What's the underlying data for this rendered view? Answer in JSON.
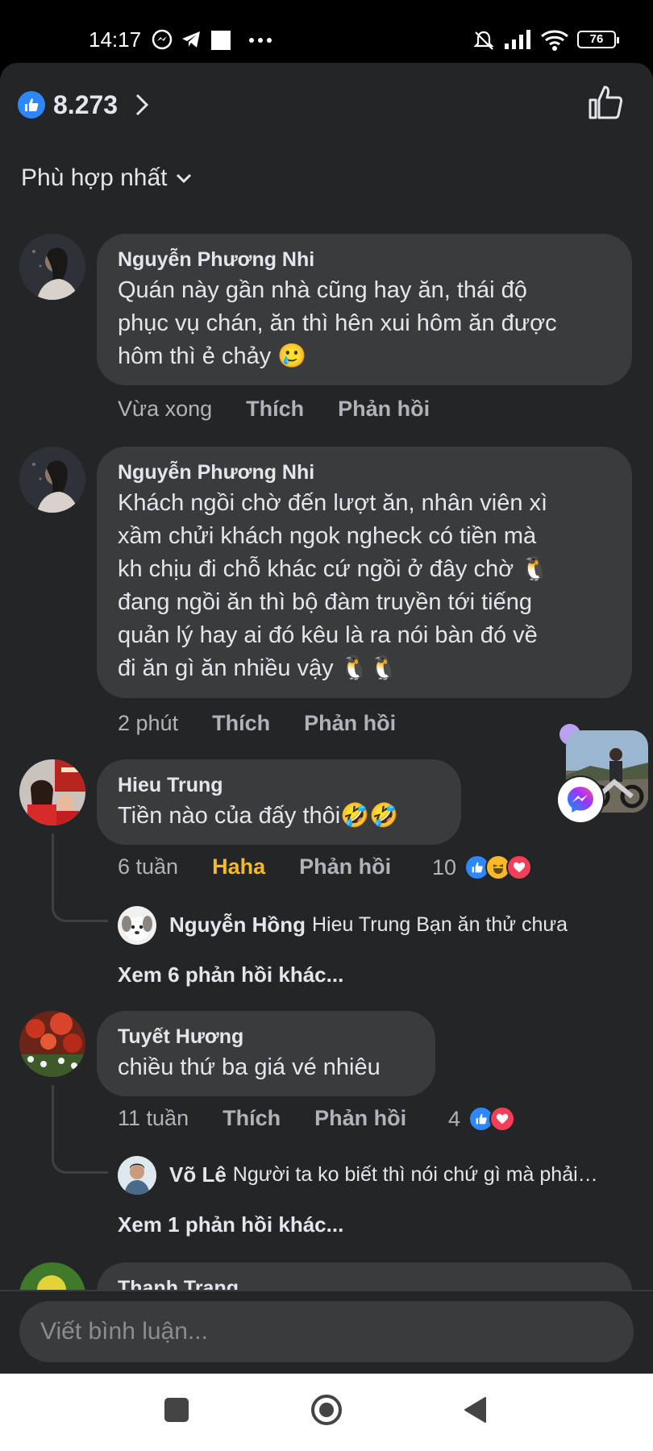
{
  "status_bar": {
    "time": "14:17",
    "battery": "76",
    "icons": [
      "messenger-icon",
      "telegram-icon",
      "square-icon",
      "more-dots-icon",
      "mute-icon",
      "signal-icon",
      "wifi-icon",
      "battery-icon"
    ]
  },
  "header": {
    "likes_count": "8.273",
    "sort_label": "Phù hợp nhất"
  },
  "comments": [
    {
      "name": "Nguyễn Phương Nhi",
      "lines": [
        "Quán này gần nhà cũng hay ăn, thái độ",
        "phục vụ chán, ăn thì hên xui hôm ăn được",
        "hôm thì ẻ chảy 🥲"
      ],
      "time": "Vừa xong",
      "like": "Thích",
      "reply": "Phản hồi"
    },
    {
      "name": "Nguyễn Phương Nhi",
      "lines": [
        "Khách ngồi chờ đến lượt ăn, nhân viên xì",
        "xầm chửi khách ngok ngheck có tiền mà",
        "kh chịu đi chỗ khác cứ ngồi ở đây chờ 🐧",
        "đang ngồi ăn thì bộ đàm truyền tới tiếng",
        "quản lý hay ai đó kêu là ra nói bàn đó về",
        "đi ăn gì ăn nhiều vậy 🐧🐧"
      ],
      "time": "2 phút",
      "like": "Thích",
      "reply": "Phản hồi"
    },
    {
      "name": "Hieu Trung",
      "lines": [
        "Tiền nào của đấy thôi🤣🤣"
      ],
      "time": "6 tuần",
      "like": "Haha",
      "reply": "Phản hồi",
      "reaction_count": "10",
      "sub_reply": {
        "name": "Nguyễn Hồng",
        "text": "Hieu Trung Bạn ăn thử chưa"
      },
      "more_replies": "Xem 6 phản hồi khác..."
    },
    {
      "name": "Tuyết Hương",
      "lines": [
        "chiều thứ ba giá vé nhiêu"
      ],
      "time": "11 tuần",
      "like": "Thích",
      "reply": "Phản hồi",
      "reaction_count": "4",
      "sub_reply": {
        "name": "Võ Lê",
        "text": "Người ta ko biết thì nói chứ gì mà phải…"
      },
      "more_replies": "Xem 1 phản hồi khác..."
    },
    {
      "name": "Thanh Trang"
    }
  ],
  "composer": {
    "placeholder": "Viết bình luận..."
  },
  "colors": {
    "panel_bg": "#242526",
    "bubble_bg": "#3a3b3c",
    "text": "#e4e6eb",
    "secondary": "#b0b3b8",
    "like_blue": "#2d88ff",
    "haha_yellow": "#f7b928",
    "love_red": "#f33e58"
  }
}
